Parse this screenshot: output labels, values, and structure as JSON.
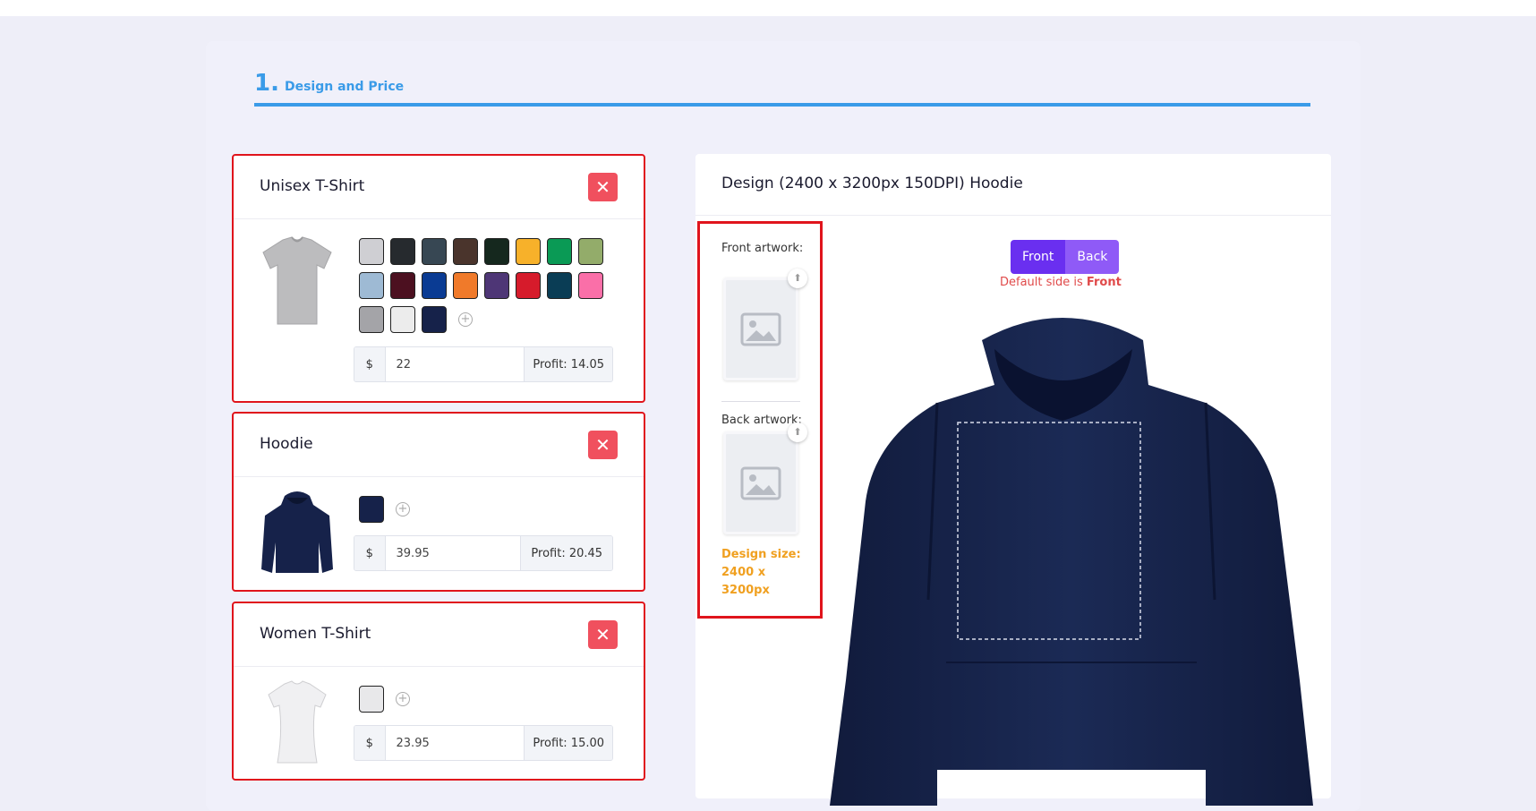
{
  "step": {
    "number": "1.",
    "label": "Design and Price"
  },
  "products": [
    {
      "title": "Unisex T-Shirt",
      "close_label": "✕",
      "thumbnail": "gray-tshirt",
      "colors": [
        "#cfcfd3",
        "#262a2e",
        "#374753",
        "#4a342c",
        "#15281e",
        "#f7b12a",
        "#0a9a55",
        "#93ac6a",
        "#9ebad4",
        "#4c1020",
        "#0a3b93",
        "#f07a2a",
        "#4e3676",
        "#d61b2b",
        "#0a3d55",
        "#fa6fa8",
        "#a4a4a8",
        "#ececec",
        "#16224a"
      ],
      "add_color_icon": "plus-circle-icon",
      "currency": "$",
      "price": "22",
      "profit": "Profit: 14.05"
    },
    {
      "title": "Hoodie",
      "close_label": "✕",
      "thumbnail": "navy-hoodie",
      "colors": [
        "#16224a"
      ],
      "add_color_icon": "plus-circle-icon",
      "currency": "$",
      "price": "39.95",
      "profit": "Profit: 20.45"
    },
    {
      "title": "Women T-Shirt",
      "close_label": "✕",
      "thumbnail": "white-tshirt",
      "colors": [
        "#e8e8ea"
      ],
      "add_color_icon": "plus-circle-icon",
      "currency": "$",
      "price": "23.95",
      "profit": "Profit: 15.00"
    }
  ],
  "design": {
    "title": "Design (2400 x 3200px 150DPI) Hoodie",
    "front_artwork_label": "Front artwork:",
    "back_artwork_label": "Back artwork:",
    "design_size_note": "Design size: 2400 x 3200px",
    "toggle": {
      "front": "Front",
      "back": "Back"
    },
    "default_side_text": "Default side is ",
    "default_side_value": "Front",
    "preview_color": "#16224a"
  },
  "colors": {
    "accent": "#3a9be8",
    "danger": "#f0505e",
    "highlight": "#e0141c",
    "toggle": "#6a2ff0",
    "warning": "#f0a020"
  }
}
